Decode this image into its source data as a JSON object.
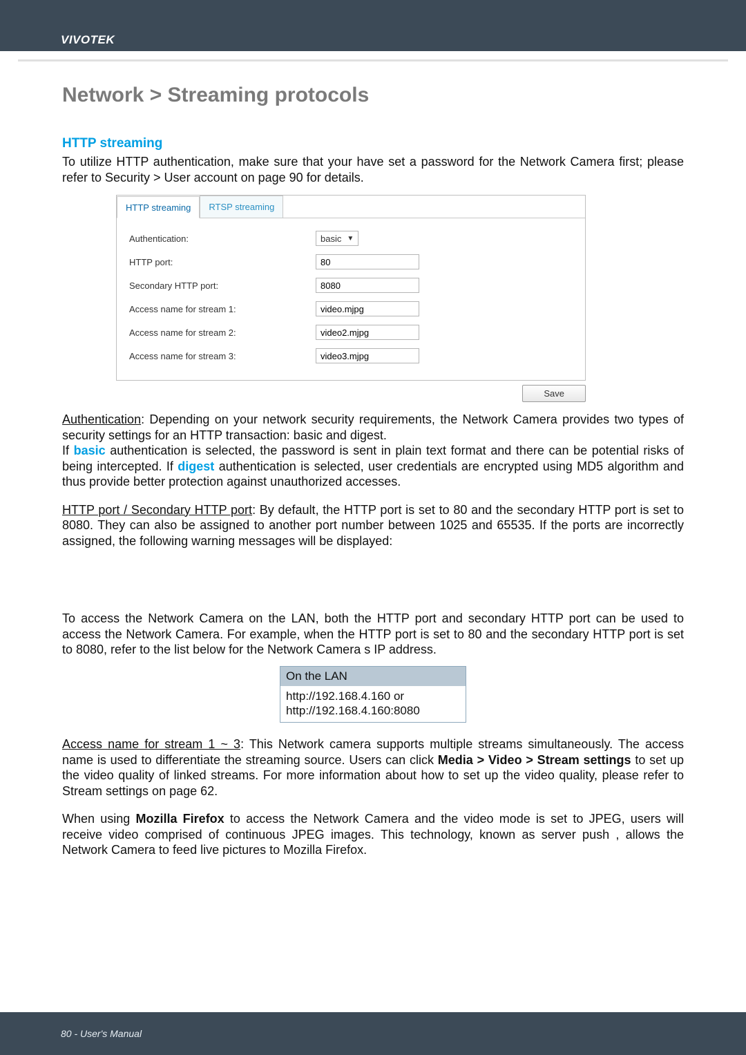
{
  "header": {
    "brand": "VIVOTEK"
  },
  "title": "Network > Streaming protocols",
  "section": {
    "http_heading": "HTTP streaming",
    "intro": "To utilize HTTP authentication, make sure that your have set a password for the Network Camera first; please refer to Security > User account on page 90 for details."
  },
  "screenshot": {
    "tabs": {
      "http": "HTTP streaming",
      "rtsp": "RTSP streaming"
    },
    "rows": {
      "auth_label": "Authentication:",
      "auth_value": "basic",
      "httpport_label": "HTTP port:",
      "httpport_value": "80",
      "sec_label": "Secondary HTTP port:",
      "sec_value": "8080",
      "s1_label": "Access name for stream 1:",
      "s1_value": "video.mjpg",
      "s2_label": "Access name for stream 2:",
      "s2_value": "video2.mjpg",
      "s3_label": "Access name for stream 3:",
      "s3_value": "video3.mjpg"
    },
    "save_label": "Save"
  },
  "para": {
    "auth_u": "Authentication",
    "auth_rest": ": Depending on your network security requirements, the Network Camera provides two types of security settings for an HTTP transaction: basic and digest.",
    "if_word": "If ",
    "basic_word": "basic",
    "basic_rest": " authentication is selected, the password is sent in plain text format and there can be potential risks of being intercepted. If ",
    "digest_word": "digest",
    "digest_rest": " authentication is selected, user credentials are encrypted using MD5 algorithm and thus provide better protection against unauthorized accesses.",
    "port_u": "HTTP port / Secondary HTTP port",
    "port_rest": ": By default, the HTTP port is set to 80 and the secondary HTTP port is set to 8080. They can also be assigned to another port number between 1025 and 65535. If the ports are incorrectly assigned, the following warning messages will be displayed:",
    "lan_para": "To access the Network Camera on the LAN, both the HTTP port and secondary HTTP port can be used to access the Network Camera. For example, when the HTTP port is set to 80 and the secondary HTTP port is set to 8080, refer to the list below for the Network Camera s IP address.",
    "access_u": "Access name for stream 1 ~ 3",
    "access_rest_1": ": This Network camera supports multiple streams simultaneously. The access name is used to differentiate the streaming source. Users can click ",
    "access_bold": "Media > Video > Stream settings",
    "access_rest_2": " to set up the video quality of linked streams. For more information about how to set up the video quality, please refer to Stream settings on page 62.",
    "ff_1": "When using ",
    "ff_bold": "Mozilla Firefox",
    "ff_2": " to access the Network Camera and the video mode is set to JPEG, users will receive video comprised of continuous JPEG images. This technology, known as server push , allows the Network Camera to feed live pictures to Mozilla Firefox."
  },
  "lan_box": {
    "head": "On the LAN",
    "line1": "http://192.168.4.160 or",
    "line2": "http://192.168.4.160:8080"
  },
  "footer": {
    "page": "80 - User's Manual"
  }
}
